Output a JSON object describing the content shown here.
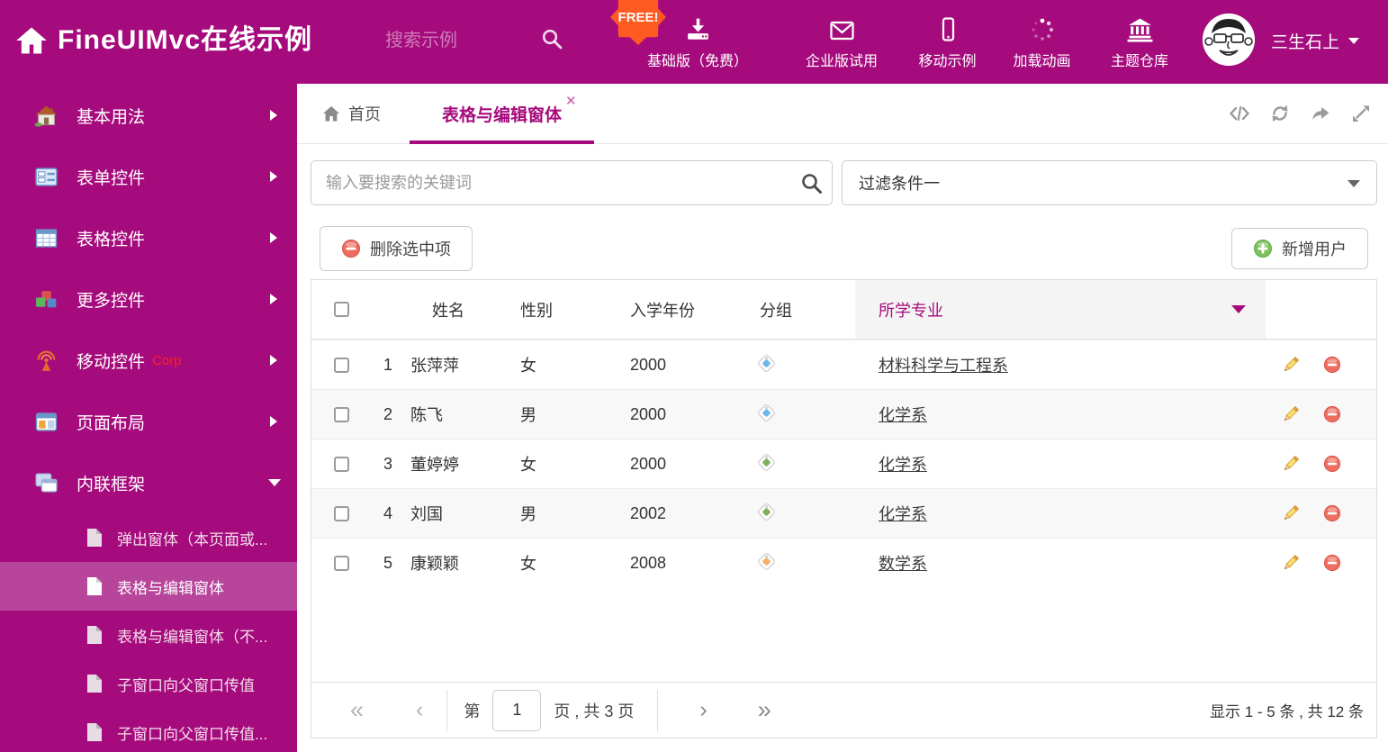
{
  "theme": {
    "accent": "#a60b7d",
    "accent_light": "#b8459c",
    "free_badge_orange": "#ff5a21",
    "danger_red": "#ed6e61",
    "success_green": "#7cc15c",
    "tag_blue": "#6db7ea",
    "tag_green": "#7fae58",
    "tag_orange": "#f9ae67"
  },
  "header": {
    "brand": "FineUIMvc在线示例",
    "search_placeholder": "搜索示例",
    "free_badge": "FREE!",
    "nav_items": [
      {
        "label": "基础版（免费）",
        "icon": "download-icon"
      },
      {
        "label": "企业版试用",
        "icon": "envelope-icon"
      },
      {
        "label": "移动示例",
        "icon": "mobile-icon"
      },
      {
        "label": "加载动画",
        "icon": "spinner-icon"
      },
      {
        "label": "主题仓库",
        "icon": "bank-icon"
      }
    ],
    "user_name": "三生石上"
  },
  "sidebar": {
    "items": [
      {
        "label": "基本用法",
        "icon": "home-icon"
      },
      {
        "label": "表单控件",
        "icon": "form-icon"
      },
      {
        "label": "表格控件",
        "icon": "table-icon"
      },
      {
        "label": "更多控件",
        "icon": "cubes-icon"
      },
      {
        "label": "移动控件",
        "badge": "Corp",
        "icon": "antenna-icon"
      },
      {
        "label": "页面布局",
        "icon": "layout-icon"
      },
      {
        "label": "内联框架",
        "icon": "frames-icon",
        "expanded": true
      }
    ],
    "subitems": [
      {
        "label": "弹出窗体（本页面或..."
      },
      {
        "label": "表格与编辑窗体",
        "active": true
      },
      {
        "label": "表格与编辑窗体（不..."
      },
      {
        "label": "子窗口向父窗口传值"
      },
      {
        "label": "子窗口向父窗口传值..."
      }
    ]
  },
  "tabs": {
    "home_label": "首页",
    "active_label": "表格与编辑窗体",
    "close_icon": "✕"
  },
  "filters": {
    "search_placeholder": "输入要搜索的关键词",
    "filter_value": "过滤条件一"
  },
  "actions": {
    "delete_label": "删除选中项",
    "add_label": "新增用户"
  },
  "grid": {
    "columns": {
      "name": "姓名",
      "gender": "性别",
      "year": "入学年份",
      "group": "分组",
      "major": "所学专业"
    },
    "rows": [
      {
        "index": "1",
        "name": "张萍萍",
        "gender": "女",
        "year": "2000",
        "tag_class": "tagshape tag-blue",
        "major": "材料科学与工程系"
      },
      {
        "index": "2",
        "name": "陈飞",
        "gender": "男",
        "year": "2000",
        "tag_class": "tagshape tag-blue",
        "major": "化学系"
      },
      {
        "index": "3",
        "name": "董婷婷",
        "gender": "女",
        "year": "2000",
        "tag_class": "tagshape tag-green",
        "major": "化学系"
      },
      {
        "index": "4",
        "name": "刘国",
        "gender": "男",
        "year": "2002",
        "tag_class": "tagshape tag-green",
        "major": "化学系"
      },
      {
        "index": "5",
        "name": "康颖颖",
        "gender": "女",
        "year": "2008",
        "tag_class": "tagshape tag-orange",
        "major": "数学系"
      }
    ]
  },
  "pagination": {
    "first_icon": "«",
    "prev_icon": "‹",
    "next_icon": "›",
    "last_icon": "»",
    "page_prefix": "第",
    "page_value": "1",
    "page_suffix": "页 , 共 3 页",
    "summary": "显示 1 - 5 条 , 共 12 条"
  },
  "icons": {
    "home-icon": "house shape (css/svg)",
    "search-icon": "magnifier (svg)",
    "download-icon": "arrow-into-tray (svg)",
    "envelope-icon": "envelope outline (svg)",
    "mobile-icon": "phone outline (svg)",
    "spinner-icon": "dotted loading ring (svg)",
    "bank-icon": "museum columns (svg)",
    "close-icon": "✕",
    "code-icon": "</> (svg)",
    "refresh-icon": "circular arrows (svg)",
    "forward-icon": "curved share arrow (svg)",
    "expand-icon": "diagonal resize arrows (svg)",
    "tag-icon": "rotated price tag (css)",
    "edit-icon": "pencil (svg)",
    "delete-icon": "red minus circle (svg)",
    "add-icon": "green plus circle (svg)",
    "chevron-right-icon": "css triangle",
    "chevron-down-icon": "css triangle",
    "pager-icons": "« ‹ › »"
  }
}
